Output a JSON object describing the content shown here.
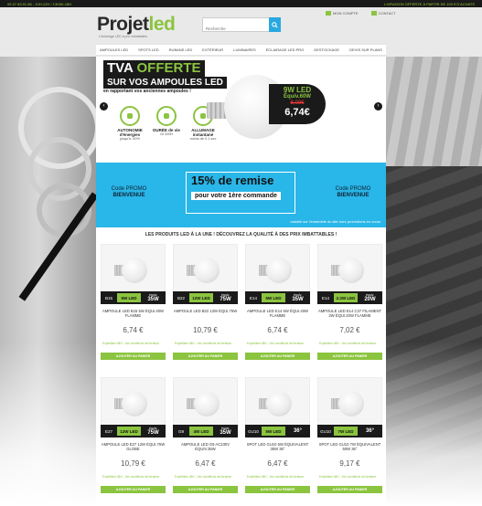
{
  "topbar": {
    "phone": "05 47 83 51 86 - 10H-12H / 13H30-18H",
    "shipping": "LIVRAISON OFFERTE À PARTIR DE 100 € D'ACHATS"
  },
  "header": {
    "logo_main": "Projet",
    "logo_accent": "led",
    "logo_tagline": "L'éclairage LED à prix imbattables",
    "search_placeholder": "Recherche",
    "account_label": "MON COMPTE",
    "contact_label": "CONTACT"
  },
  "nav": [
    "AMPOULES LED",
    "SPOTS LED",
    "RUBANS LED",
    "EXTÉRIEUR",
    "LUMINAIRES",
    "ÉCLAIRAGE LED PRO",
    "DESTOCKAGE",
    "DEVIS SUR PLANS"
  ],
  "hero": {
    "title_a": "TVA",
    "title_b": "OFFERTE",
    "subtitle": "SUR VOS AMPOULES LED",
    "note": "en rapportant vos anciennes ampoules !",
    "features": [
      {
        "label": "AUTONOMIE d'énergies",
        "sub": "jusqu'à -90%"
      },
      {
        "label": "DURÉE de vie",
        "sub": "15 000H"
      },
      {
        "label": "ALLUMAGE instantané",
        "sub": "moins de 0.1 sec"
      }
    ],
    "tag_watt": "9W LED",
    "tag_eq": "Équiv.60W",
    "tag_old": "8,09€",
    "tag_new": "6,74€"
  },
  "promo": {
    "code_left": "Code PROMO",
    "code_left_b": "BIENVENUE",
    "discount": "15% de remise",
    "first_order": "pour votre 1ère commande",
    "code_right": "Code PROMO",
    "code_right_b": "BIENVENUE",
    "validity": "valable sur l'ensemble du site hors promotions en cours"
  },
  "section_title": "LES PRODUITS LED À LA UNE ! DÉCOUVREZ LA QUALITÉ À DES PRIX IMBATTABLES !",
  "products": [
    {
      "cap": "B15",
      "watt": "5W LED",
      "eq": "35W",
      "name": "AMPOULE LED B15 5W ÉQUI.40W FLAMME",
      "price": "6,74 €",
      "stock": "Expédition 48H - Voir conditions de livraison",
      "cta": "AJOUTER AU PANIER"
    },
    {
      "cap": "B22",
      "watt": "12W LED",
      "eq": "75W",
      "name": "AMPOULE LED B22 12W ÉQUI.75W",
      "price": "10,79 €",
      "stock": "Expédition 48H - Voir conditions de livraison",
      "cta": "AJOUTER AU PANIER"
    },
    {
      "cap": "E14",
      "watt": "5W LED",
      "eq": "35W",
      "name": "AMPOULE LED E14 5W ÉQUI.40W FLAMME",
      "price": "6,74 €",
      "stock": "Expédition 48H - Voir conditions de livraison",
      "cta": "AJOUTER AU PANIER"
    },
    {
      "cap": "E14",
      "watt": "2.2W LED",
      "eq": "20W",
      "name": "AMPOULE LED E14 C37 FILAMENT 2W ÉQUI.20W FLAMME",
      "price": "7,02 €",
      "stock": "Expédition 48H - Voir conditions de livraison",
      "cta": "AJOUTER AU PANIER"
    },
    {
      "cap": "E27",
      "watt": "12W LED",
      "eq": "75W",
      "name": "AMPOULE LED E27 12W ÉQUI.75W GLOBE",
      "price": "10,79 €",
      "stock": "Expédition 48H - Voir conditions de livraison",
      "cta": "AJOUTER AU PANIER"
    },
    {
      "cap": "G9",
      "watt": "4W LED",
      "eq": "35W",
      "name": "AMPOULE LED G9 AC230V ÉQUIV.35W",
      "price": "6,47 €",
      "stock": "Expédition 48H - Voir conditions de livraison",
      "cta": "AJOUTER AU PANIER"
    },
    {
      "cap": "GU10",
      "watt": "5W LED",
      "eq": "36°",
      "name": "SPOT LED GU10 5W ÉQUIVALENT 35W 36°",
      "price": "6,47 €",
      "stock": "Expédition 48H - Voir conditions de livraison",
      "cta": "AJOUTER AU PANIER"
    },
    {
      "cap": "GU10",
      "watt": "7W LED",
      "eq": "36°",
      "name": "SPOT LED GU10 7W ÉQUIVALENT 50W 36°",
      "price": "9,17 €",
      "stock": "Expédition 48H - Voir conditions de livraison",
      "cta": "AJOUTER AU PANIER"
    }
  ]
}
